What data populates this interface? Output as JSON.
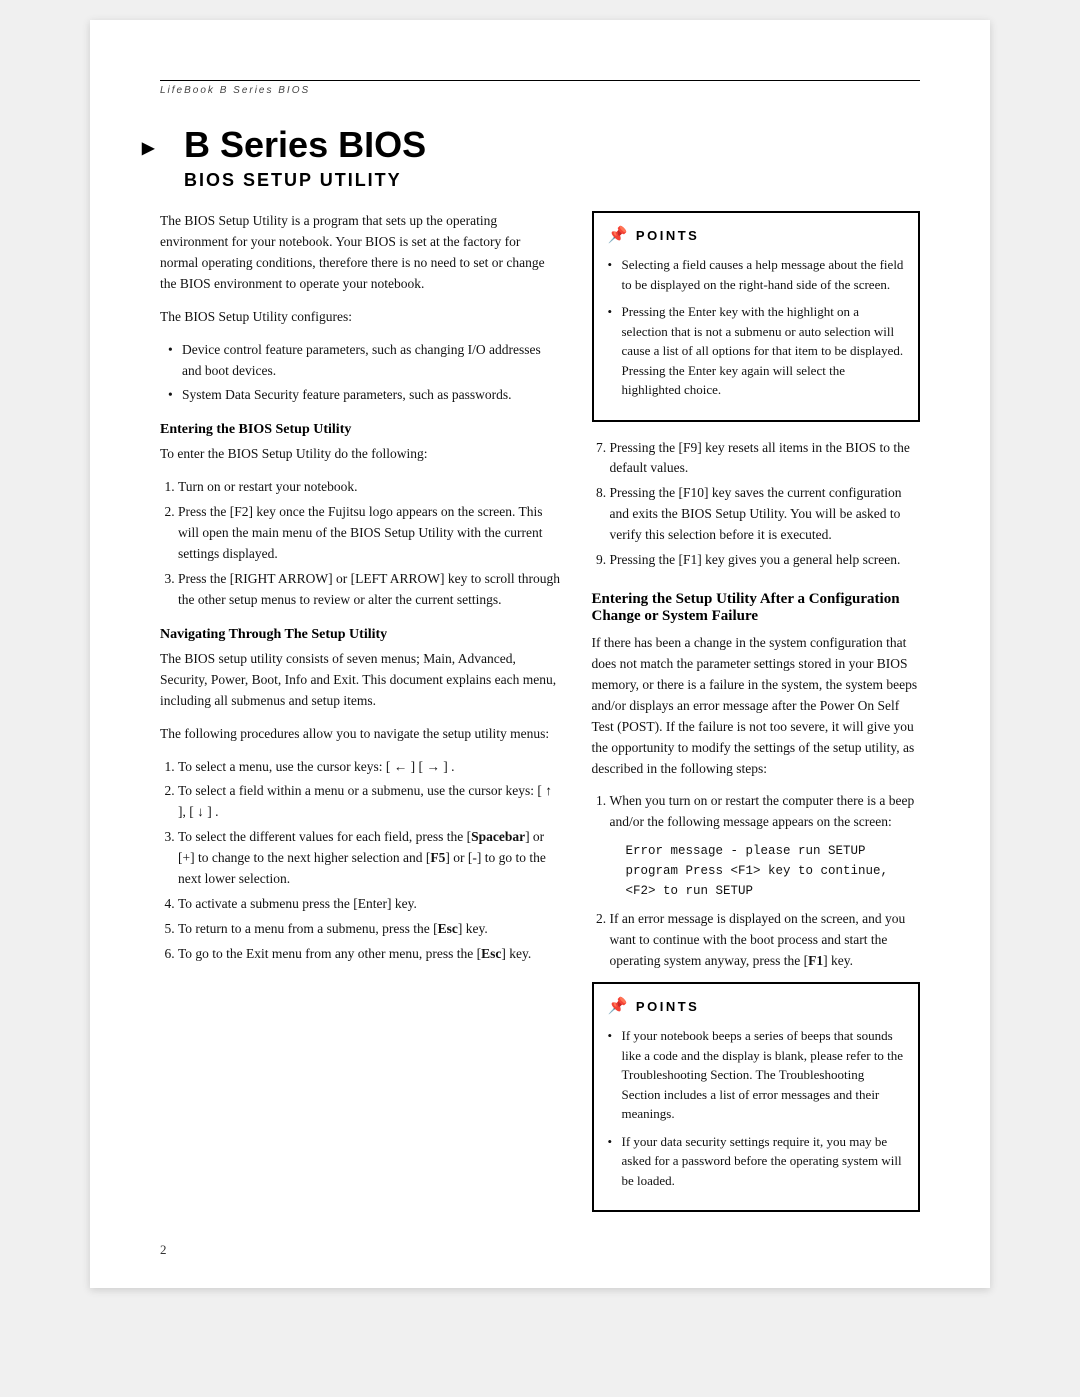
{
  "header": {
    "title": "LifeBook B Series BIOS",
    "page_number": "2"
  },
  "main_title": "B Series BIOS",
  "subtitle": "BIOS SETUP UTILITY",
  "intro_text": "The BIOS Setup Utility is a program that sets up the operating environment for your notebook. Your BIOS is set at the factory for normal operating conditions, therefore there is no need to set or change the BIOS environment to operate your notebook.",
  "configures_label": "The BIOS Setup Utility configures:",
  "configures_items": [
    "Device control feature parameters, such as changing I/O addresses and boot devices.",
    "System Data Security feature parameters, such as passwords."
  ],
  "sections": {
    "entering_bios": {
      "heading": "Entering the BIOS Setup Utility",
      "intro": "To enter the BIOS Setup Utility do the following:",
      "steps": [
        "Turn on or restart your notebook.",
        "Press the [F2] key once the Fujitsu logo appears on the screen. This will open the main menu of the BIOS Setup Utility with the current settings displayed.",
        "Press the [RIGHT ARROW] or [LEFT ARROW] key to scroll through the other setup menus to review or alter the current settings."
      ]
    },
    "navigating": {
      "heading": "Navigating Through The Setup Utility",
      "para1": "The BIOS setup utility consists of seven menus; Main, Advanced, Security, Power, Boot, Info and Exit. This document explains each menu, including all submenus and setup items.",
      "para2": "The following procedures allow you to navigate the setup utility menus:",
      "steps": [
        "To select a menu, use the cursor keys: [ ← ] [ → ] .",
        "To select a field within a menu or a submenu, use the cursor keys: [ ↑ ], [ ↓ ] .",
        "To select the different values for each field, press the [Spacebar] or [+] to change to the next higher selection and [F5] or [-] to go to the next lower selection.",
        "To activate a submenu press the [Enter] key.",
        "To return to a menu from a submenu, press the [Esc] key.",
        "To go to the Exit menu from any other menu, press the [Esc] key."
      ]
    }
  },
  "right_column": {
    "points_box_1": {
      "header": "POINTS",
      "items": [
        "Selecting a field causes a help message about the field to be displayed on the right-hand side of the screen.",
        "Pressing the Enter key with the highlight on a selection that is not a submenu or auto selection will cause a list of all options for that item to be displayed. Pressing the Enter key again will select the highlighted choice."
      ]
    },
    "numbered_items_789": [
      "Pressing the [F9] key resets all items in the BIOS to the default values.",
      "Pressing the [F10] key saves the current configuration and exits the BIOS Setup Utility. You will be asked to verify this selection before it is executed.",
      "Pressing the [F1] key gives you a general help screen."
    ],
    "config_failure": {
      "heading": "Entering the Setup Utility After a Configuration Change or System Failure",
      "para1": "If there has been a change in the system configuration that does not match the parameter settings stored in your BIOS memory, or there is a failure in the system, the system beeps and/or displays an error message after the Power On Self Test (POST). If the failure is not too severe, it will give you the opportunity to modify the settings of the setup utility, as described in the following steps:",
      "step1_intro": "When you turn on or restart the computer there is a beep and/or the following message appears on the screen:",
      "monospace": "Error message - please run SETUP\nprogram Press <F1> key to continue,\n<F2> to run SETUP",
      "step2": "If an error message is displayed on the screen, and you want to continue with the boot process and start the operating system anyway, press the [F1] key."
    },
    "points_box_2": {
      "header": "POINTS",
      "items": [
        "If your notebook beeps a series of beeps that sounds like a code and the display is blank, please refer to the Troubleshooting Section. The Troubleshooting Section includes a list of error messages and their meanings.",
        "If your data security settings require it, you may be asked for a password before the operating system will be loaded."
      ]
    }
  }
}
